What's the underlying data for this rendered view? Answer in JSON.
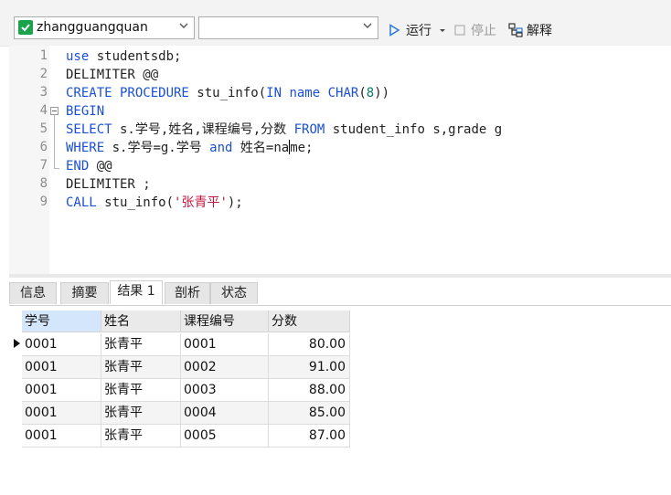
{
  "toolbar": {
    "database": "zhangguangquan",
    "second_combo": "",
    "run_label": "运行",
    "stop_label": "停止",
    "explain_label": "解释"
  },
  "editor": {
    "line_numbers": [
      "1",
      "2",
      "3",
      "4",
      "5",
      "6",
      "7",
      "8",
      "9"
    ]
  },
  "tabs": [
    "信息",
    "摘要",
    "结果 1",
    "剖析",
    "状态"
  ],
  "active_tab": "结果 1",
  "grid": {
    "columns": [
      "学号",
      "姓名",
      "课程编号",
      "分数"
    ],
    "rows": [
      [
        "0001",
        "张青平",
        "0001",
        "80.00"
      ],
      [
        "0001",
        "张青平",
        "0002",
        "91.00"
      ],
      [
        "0001",
        "张青平",
        "0003",
        "88.00"
      ],
      [
        "0001",
        "张青平",
        "0004",
        "85.00"
      ],
      [
        "0001",
        "张青平",
        "0005",
        "87.00"
      ]
    ]
  },
  "colors": {
    "keyword": "#1a4fd6",
    "string": "#c0163d",
    "header_selected": "#d4e6fb"
  }
}
